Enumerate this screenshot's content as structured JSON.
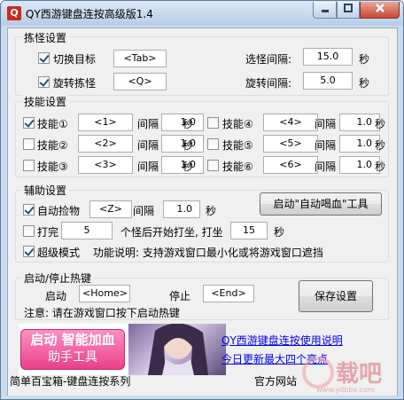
{
  "window": {
    "title": "QY西游键盘连按高级版1.4",
    "icon_char": "Q"
  },
  "monster": {
    "legend": "拣怪设置",
    "switch_target": {
      "label": "切换目标",
      "checked": true,
      "key": "<Tab>"
    },
    "rotate_monster": {
      "label": "旋转拣怪",
      "checked": true,
      "key": "<Q>"
    },
    "select_interval": {
      "label": "选怪间隔:",
      "value": "15.0",
      "unit": "秒"
    },
    "rotate_interval": {
      "label": "旋转间隔:",
      "value": "5.0",
      "unit": "秒"
    }
  },
  "skills": {
    "legend": "技能设置",
    "interval_label": "间隔",
    "unit": "秒",
    "items": [
      {
        "label": "技能①",
        "checked": true,
        "key": "<1>",
        "interval": "1.0"
      },
      {
        "label": "技能②",
        "checked": false,
        "key": "<2>",
        "interval": "1.0"
      },
      {
        "label": "技能③",
        "checked": false,
        "key": "<3>",
        "interval": "1.0"
      },
      {
        "label": "技能④",
        "checked": false,
        "key": "<4>",
        "interval": "1.0"
      },
      {
        "label": "技能⑤",
        "checked": false,
        "key": "<5>",
        "interval": "1.0"
      },
      {
        "label": "技能⑥",
        "checked": false,
        "key": "<6>",
        "interval": "1.0"
      }
    ]
  },
  "aux": {
    "legend": "辅助设置",
    "auto_pickup": {
      "label": "自动捡物",
      "checked": true,
      "key": "<Z>",
      "interval_label": "间隔",
      "interval": "1.0",
      "unit": "秒"
    },
    "auto_drink_button": "启动\"自动喝血\"工具",
    "sit": {
      "label": "打完",
      "checked": false,
      "count": "5",
      "mid_text": "个怪后开始打坐, 打坐",
      "duration": "15",
      "unit": "秒"
    },
    "super_mode": {
      "label": "超级模式",
      "checked": true,
      "description": "功能说明: 支持游戏窗口最小化或将游戏窗口遮挡"
    }
  },
  "hotkeys": {
    "legend": "启动/停止热键",
    "start_label": "启动",
    "start_key": "<Home>",
    "stop_label": "停止",
    "stop_key": "<End>",
    "note": "注意: 请在游戏窗口按下启动热键",
    "save_button": "保存设置"
  },
  "ad": {
    "line1": "启动 智能加血",
    "line2": "助手工具",
    "link1": "QY西游键盘连按使用说明",
    "link2": "今日更新最大四个亮点"
  },
  "footer": {
    "left": "简单百宝箱-键盘连按系列",
    "right": "官方网站"
  },
  "watermark": {
    "text": "载吧",
    "url": "www.ydbbx.com"
  }
}
